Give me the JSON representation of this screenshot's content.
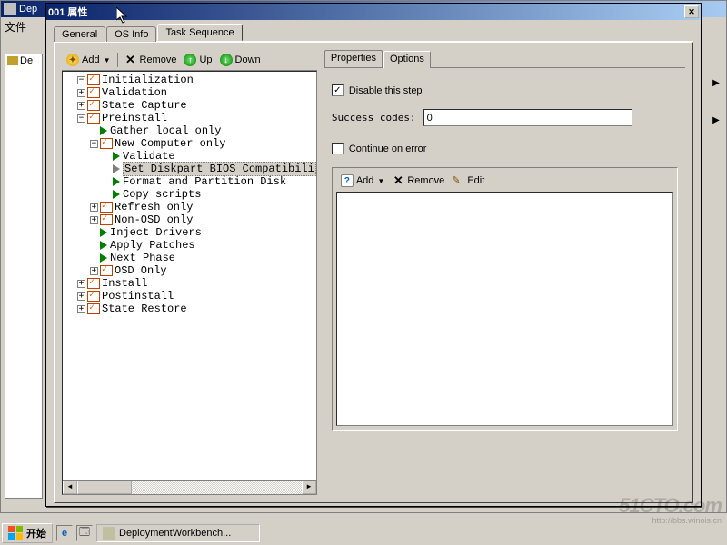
{
  "bg": {
    "title_prefix": "Dep",
    "menu_file": "文件",
    "tree_root": "De"
  },
  "dialog": {
    "title": "001 属性",
    "tabs": {
      "general": "General",
      "osinfo": "OS Info",
      "tasksequence": "Task Sequence"
    },
    "toolbar": {
      "add": "Add",
      "remove": "Remove",
      "up": "Up",
      "down": "Down"
    },
    "tree": [
      {
        "depth": 0,
        "exp": "-",
        "ico": "check",
        "label": "Initialization"
      },
      {
        "depth": 0,
        "exp": "+",
        "ico": "check",
        "label": "Validation"
      },
      {
        "depth": 0,
        "exp": "+",
        "ico": "check",
        "label": "State Capture"
      },
      {
        "depth": 0,
        "exp": "-",
        "ico": "check",
        "label": "Preinstall"
      },
      {
        "depth": 1,
        "exp": "",
        "ico": "arrow",
        "label": "Gather local only"
      },
      {
        "depth": 1,
        "exp": "-",
        "ico": "check",
        "label": "New Computer only"
      },
      {
        "depth": 2,
        "exp": "",
        "ico": "arrow",
        "label": "Validate"
      },
      {
        "depth": 2,
        "exp": "",
        "ico": "arrow-gray",
        "label": "Set Diskpart BIOS Compatibili",
        "selected": true
      },
      {
        "depth": 2,
        "exp": "",
        "ico": "arrow",
        "label": "Format and Partition Disk"
      },
      {
        "depth": 2,
        "exp": "",
        "ico": "arrow",
        "label": "Copy scripts"
      },
      {
        "depth": 1,
        "exp": "+",
        "ico": "check",
        "label": "Refresh only"
      },
      {
        "depth": 1,
        "exp": "+",
        "ico": "check",
        "label": "Non-OSD only"
      },
      {
        "depth": 1,
        "exp": "",
        "ico": "arrow",
        "label": "Inject Drivers"
      },
      {
        "depth": 1,
        "exp": "",
        "ico": "arrow",
        "label": "Apply Patches"
      },
      {
        "depth": 1,
        "exp": "",
        "ico": "arrow",
        "label": "Next Phase"
      },
      {
        "depth": 1,
        "exp": "+",
        "ico": "check",
        "label": "OSD Only"
      },
      {
        "depth": 0,
        "exp": "+",
        "ico": "check",
        "label": "Install"
      },
      {
        "depth": 0,
        "exp": "+",
        "ico": "check",
        "label": "Postinstall"
      },
      {
        "depth": 0,
        "exp": "+",
        "ico": "check",
        "label": "State Restore"
      }
    ],
    "subtabs": {
      "properties": "Properties",
      "options": "Options"
    },
    "options": {
      "disable_label": "Disable this step",
      "disable_checked": true,
      "success_label": "Success codes:",
      "success_value": "0",
      "continue_label": "Continue on error",
      "continue_checked": false,
      "cond_add": "Add",
      "cond_remove": "Remove",
      "cond_edit": "Edit"
    }
  },
  "taskbar": {
    "start": "开始",
    "app": "DeploymentWorkbench..."
  },
  "watermark": {
    "main": "51CTO.com",
    "sub": "http://bbs.winois.cn"
  }
}
